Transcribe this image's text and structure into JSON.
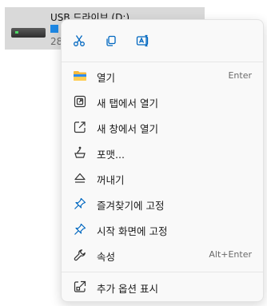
{
  "drive": {
    "name": "USB 드라이브 (D:)",
    "space": "28"
  },
  "menu": {
    "quick_actions": [
      {
        "name": "cut",
        "icon": "scissors-icon"
      },
      {
        "name": "copy",
        "icon": "copy-icon"
      },
      {
        "name": "rename",
        "icon": "rename-icon"
      }
    ],
    "items": [
      {
        "label": "열기",
        "shortcut": "Enter",
        "icon": "folder-icon"
      },
      {
        "label": "새 탭에서 열기",
        "shortcut": "",
        "icon": "open-new-tab-icon"
      },
      {
        "label": "새 창에서 열기",
        "shortcut": "",
        "icon": "open-new-window-icon"
      },
      {
        "label": "포맷...",
        "shortcut": "",
        "icon": "format-icon"
      },
      {
        "label": "꺼내기",
        "shortcut": "",
        "icon": "eject-icon"
      },
      {
        "label": "즐겨찾기에 고정",
        "shortcut": "",
        "icon": "pin-icon"
      },
      {
        "label": "시작 화면에 고정",
        "shortcut": "",
        "icon": "pin-icon"
      },
      {
        "label": "속성",
        "shortcut": "Alt+Enter",
        "icon": "wrench-icon"
      }
    ],
    "more": {
      "label": "추가 옵션 표시",
      "icon": "show-more-icon"
    }
  },
  "colors": {
    "accent": "#0067c0",
    "menu_bg": "#f9f9f9",
    "selection": "#d9d9d9"
  }
}
